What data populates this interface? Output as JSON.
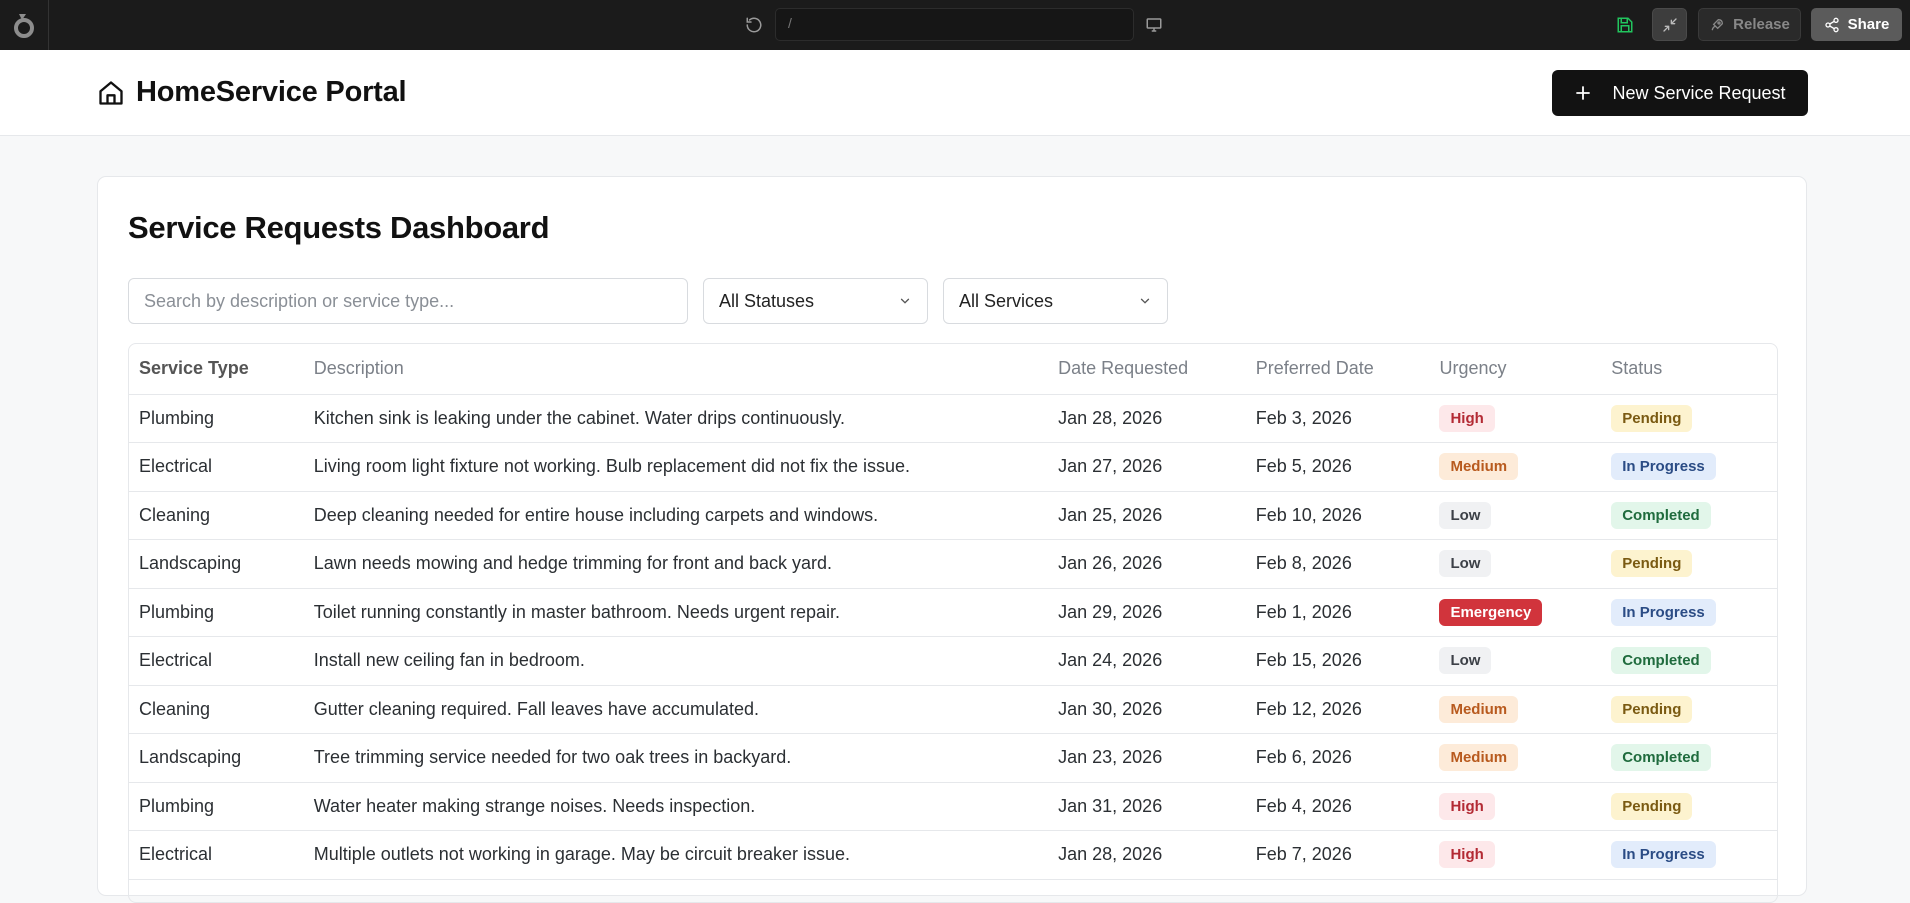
{
  "editor_bar": {
    "url_text": "/",
    "release_label": "Release",
    "share_label": "Share"
  },
  "header": {
    "title": "HomeService Portal",
    "new_request_label": "New Service Request"
  },
  "dashboard": {
    "title": "Service Requests Dashboard",
    "search_placeholder": "Search by description or service type...",
    "status_filter": "All Statuses",
    "service_filter": "All Services",
    "columns": [
      "Service Type",
      "Description",
      "Date Requested",
      "Preferred Date",
      "Urgency",
      "Status"
    ],
    "rows": [
      {
        "service": "Plumbing",
        "description": "Kitchen sink is leaking under the cabinet. Water drips continuously.",
        "requested": "Jan 28, 2026",
        "preferred": "Feb 3, 2026",
        "urgency": "High",
        "status": "Pending"
      },
      {
        "service": "Electrical",
        "description": "Living room light fixture not working. Bulb replacement did not fix the issue.",
        "requested": "Jan 27, 2026",
        "preferred": "Feb 5, 2026",
        "urgency": "Medium",
        "status": "In Progress"
      },
      {
        "service": "Cleaning",
        "description": "Deep cleaning needed for entire house including carpets and windows.",
        "requested": "Jan 25, 2026",
        "preferred": "Feb 10, 2026",
        "urgency": "Low",
        "status": "Completed"
      },
      {
        "service": "Landscaping",
        "description": "Lawn needs mowing and hedge trimming for front and back yard.",
        "requested": "Jan 26, 2026",
        "preferred": "Feb 8, 2026",
        "urgency": "Low",
        "status": "Pending"
      },
      {
        "service": "Plumbing",
        "description": "Toilet running constantly in master bathroom. Needs urgent repair.",
        "requested": "Jan 29, 2026",
        "preferred": "Feb 1, 2026",
        "urgency": "Emergency",
        "status": "In Progress"
      },
      {
        "service": "Electrical",
        "description": "Install new ceiling fan in bedroom.",
        "requested": "Jan 24, 2026",
        "preferred": "Feb 15, 2026",
        "urgency": "Low",
        "status": "Completed"
      },
      {
        "service": "Cleaning",
        "description": "Gutter cleaning required. Fall leaves have accumulated.",
        "requested": "Jan 30, 2026",
        "preferred": "Feb 12, 2026",
        "urgency": "Medium",
        "status": "Pending"
      },
      {
        "service": "Landscaping",
        "description": "Tree trimming service needed for two oak trees in backyard.",
        "requested": "Jan 23, 2026",
        "preferred": "Feb 6, 2026",
        "urgency": "Medium",
        "status": "Completed"
      },
      {
        "service": "Plumbing",
        "description": "Water heater making strange noises. Needs inspection.",
        "requested": "Jan 31, 2026",
        "preferred": "Feb 4, 2026",
        "urgency": "High",
        "status": "Pending"
      },
      {
        "service": "Electrical",
        "description": "Multiple outlets not working in garage. May be circuit breaker issue.",
        "requested": "Jan 28, 2026",
        "preferred": "Feb 7, 2026",
        "urgency": "High",
        "status": "In Progress"
      }
    ]
  },
  "colors": {
    "topbar": "#1b1b1b",
    "primary_button": "#121212",
    "save_icon": "#22c55e",
    "urgency_emergency": "#d1343c"
  }
}
